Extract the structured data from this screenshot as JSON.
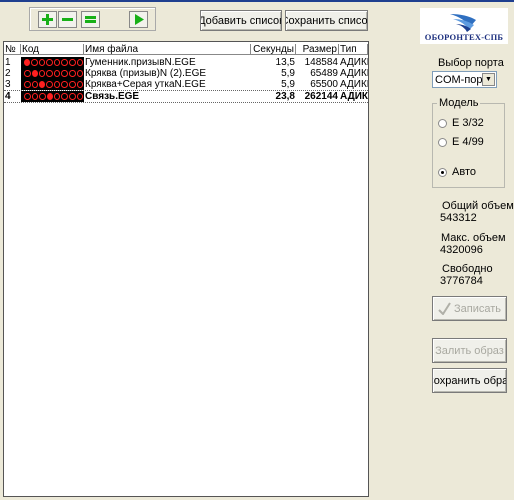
{
  "toolbar": {
    "add_icon": "plus-icon",
    "remove_icon": "minus-icon",
    "list_icon": "equals-icon",
    "play_icon": "play-icon",
    "add_list_label": "Добавить список",
    "save_list_label": "Сохранить список"
  },
  "logo": {
    "text": "ОБОРОНТЕХ-СПБ"
  },
  "table": {
    "headers": {
      "num": "№",
      "code": "Код",
      "file": "Имя файла",
      "seconds": "Секунды",
      "size": "Размер",
      "type": "Тип"
    },
    "rows": [
      {
        "num": "1",
        "file": "Гуменник.призывN.EGE",
        "seconds": "13,5",
        "size": "148584",
        "type": "АДИКМ",
        "code_dots": [
          1,
          0,
          0,
          0,
          0,
          0,
          0,
          0
        ]
      },
      {
        "num": "2",
        "file": "Кряква (призыв)N (2).EGE",
        "seconds": "5,9",
        "size": "65489",
        "type": "АДИКМ",
        "code_dots": [
          0,
          1,
          0,
          0,
          0,
          0,
          0,
          0
        ]
      },
      {
        "num": "3",
        "file": "Кряква+Серая уткаN.EGE",
        "seconds": "5,9",
        "size": "65500",
        "type": "АДИКМ",
        "code_dots": [
          0,
          0,
          1,
          0,
          0,
          0,
          0,
          0
        ]
      },
      {
        "num": "4",
        "file": "Связь.EGE",
        "seconds": "23,8",
        "size": "262144",
        "type": "АДИКМ",
        "code_dots": [
          0,
          0,
          0,
          1,
          0,
          0,
          0,
          0
        ]
      }
    ]
  },
  "port": {
    "label": "Выбор порта",
    "selected": "COM-порт"
  },
  "model": {
    "title": "Модель",
    "options": [
      {
        "label": "Е 3/32",
        "checked": false
      },
      {
        "label": "Е 4/99",
        "checked": false
      },
      {
        "label": "Авто",
        "checked": true
      }
    ]
  },
  "stats": {
    "total_label": "Общий объем",
    "total_value": "543312",
    "max_label": "Макс. объем",
    "max_value": "4320096",
    "free_label": "Свободно",
    "free_value": "3776784"
  },
  "actions": {
    "write_label": "Записать",
    "write_icon": "check-icon",
    "upload_image_label": "Залить образ",
    "save_image_label": "Сохранить образ"
  },
  "colors": {
    "dot_active": "#ff2020",
    "code_bg": "#000000",
    "accent": "#1f3f8f"
  }
}
